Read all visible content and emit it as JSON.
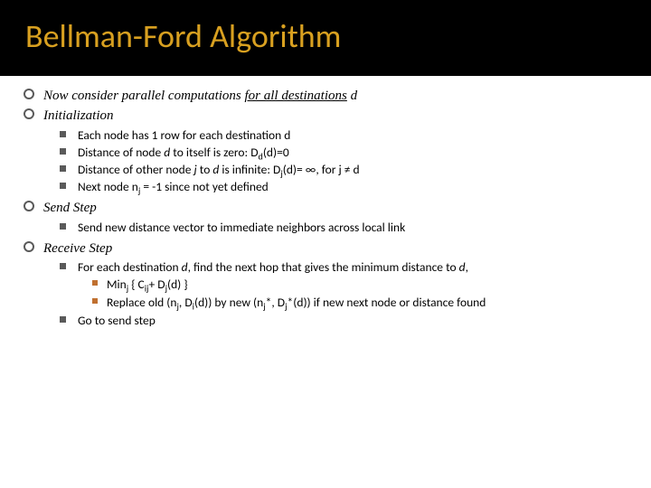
{
  "title": "Bellman-Ford Algorithm",
  "items": [
    {
      "html": "Now consider parallel computations <span class='underline'>for all destinations</span> d"
    },
    {
      "html": "Initialization",
      "children": [
        {
          "html": "Each node has 1 row for each destination d"
        },
        {
          "html": "Distance of node <i>d</i> to itself is zero: D<sub>d</sub>(d)=0"
        },
        {
          "html": "Distance of other node <i>j</i> to <i>d</i> is infinite: D<sub>j</sub>(d)= ∞, for j ≠ d"
        },
        {
          "html": "Next node n<sub>j</sub> = -1 since not yet defined"
        }
      ]
    },
    {
      "html": "Send Step",
      "children": [
        {
          "html": "Send new distance vector to immediate neighbors across local link"
        }
      ]
    },
    {
      "html": "Receive Step",
      "children": [
        {
          "html": "For each destination <i>d</i>, find the next hop that gives the minimum distance to <i>d</i>,",
          "children": [
            {
              "html": "Min<sub>j</sub> { C<sub>ij</sub>+ D<sub>j</sub>(d) }"
            },
            {
              "html": "Replace old (n<sub>j</sub>, D<sub>i</sub>(d)) by new (n<sub>j</sub>*, D<sub>j</sub>*(d)) if new next node or distance found"
            }
          ]
        },
        {
          "html": "Go to send step"
        }
      ]
    }
  ]
}
